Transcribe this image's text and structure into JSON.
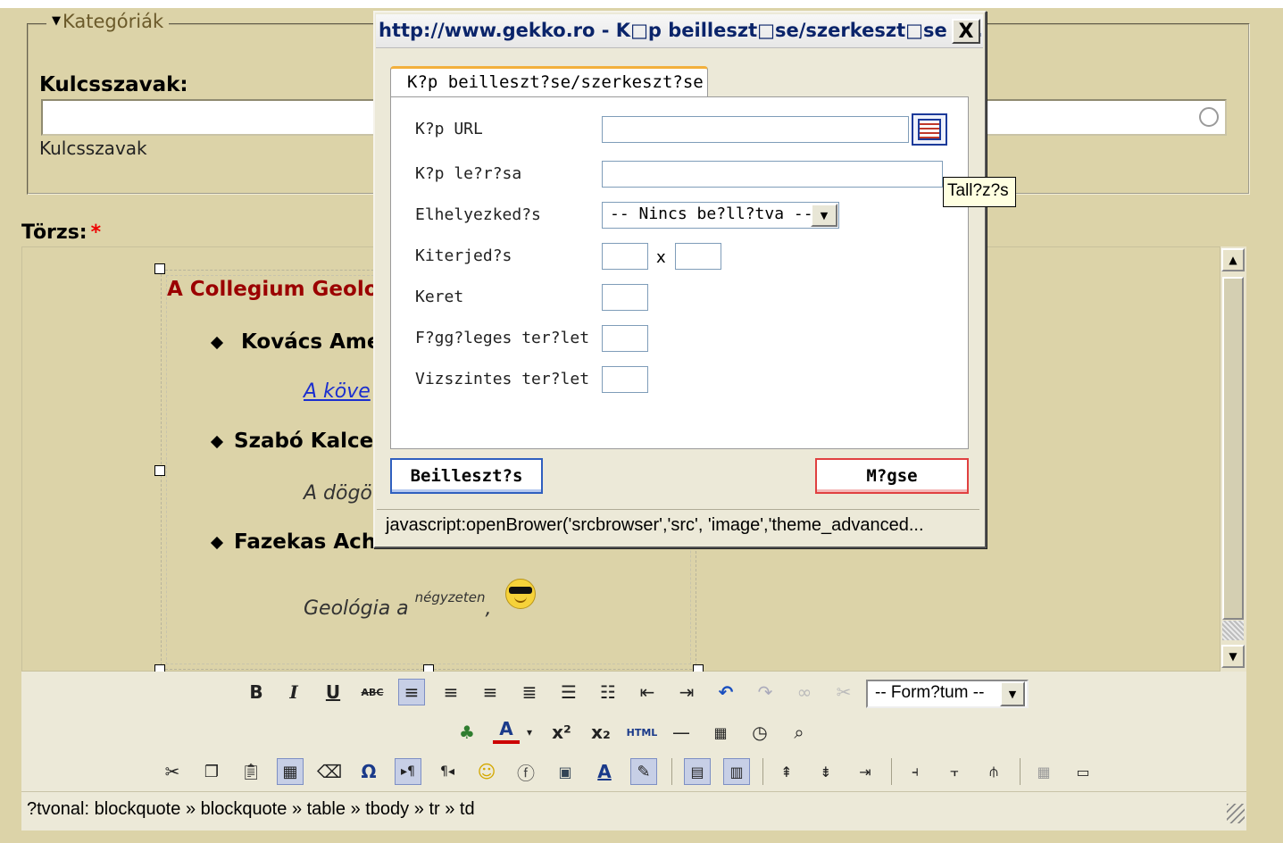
{
  "page_top_cutoff_text": "",
  "categories": {
    "legend": "Kategóriák"
  },
  "keywords": {
    "label": "Kulcsszavak:",
    "value": "",
    "help": "Kulcsszavak"
  },
  "body_field": {
    "label": "Törzs:",
    "required_mark": "*"
  },
  "editor_content": {
    "heading": "A Collegium Geolog",
    "items": [
      {
        "name": "Kovács Ame",
        "sub": "A köve",
        "sub_is_link": true
      },
      {
        "name": "Szabó  Kalce",
        "sub": "A dögö",
        "sub_is_link": false
      },
      {
        "name": "Fazekas Ach",
        "sub": "Geológia a",
        "sub_sup": "négyzeten",
        "sub_suffix": ",",
        "has_emoticon": true
      }
    ]
  },
  "toolbar": {
    "row1": [
      "bold-icon",
      "italic-icon",
      "underline-icon",
      "strikethrough-icon",
      "align-left-icon",
      "align-center-icon",
      "align-right-icon",
      "align-justify-icon",
      "bullet-list-icon",
      "numbered-list-icon",
      "outdent-icon",
      "indent-icon",
      "undo-icon",
      "redo-icon",
      "link-icon",
      "unlink-icon"
    ],
    "format_select": "-- Form?tum --",
    "row2": [
      "image-icon",
      "font-color-icon",
      "superscript-icon",
      "subscript-icon",
      "html-icon",
      "hr-icon",
      "date-icon",
      "time-icon",
      "preview-icon"
    ],
    "row3": [
      "cut-icon",
      "copy-icon",
      "paste-icon",
      "table-icon",
      "eraser-icon",
      "omega-icon",
      "ltr-icon",
      "rtl-icon",
      "emoticon-icon",
      "flash-icon",
      "media-icon",
      "font-a-icon",
      "edit-icon",
      "row-props-icon",
      "cell-props-icon",
      "insert-row-before-icon",
      "insert-row-after-icon",
      "delete-row-icon",
      "insert-col-before-icon",
      "insert-col-after-icon",
      "delete-col-icon",
      "split-cells-icon",
      "merge-cells-icon"
    ]
  },
  "path_bar": {
    "label": "?tvonal:",
    "path": [
      "blockquote",
      "blockquote",
      "table",
      "tbody",
      "tr",
      "td"
    ],
    "separator": "»"
  },
  "popup": {
    "title": "http://www.gekko.ro - K□p beilleszt□se/szerkeszt□se -...",
    "close": "X",
    "tab": "K?p beilleszt?se/szerkeszt?se",
    "fields": {
      "url": "K?p URL",
      "desc": "K?p le?r?sa",
      "align": "Elhelyezked?s",
      "dimensions": "Kiterjed?s",
      "border": "Keret",
      "vspace": "F?gg?leges ter?let",
      "hspace": "Vizszintes ter?let"
    },
    "align_value": "-- Nincs be?ll?tva --",
    "dim_separator": "x",
    "tooltip": "Tall?z?s",
    "insert_button": "Beilleszt?s",
    "cancel_button": "M?gse",
    "status": "javascript:openBrower('srcbrowser','src', 'image','theme_advanced..."
  }
}
